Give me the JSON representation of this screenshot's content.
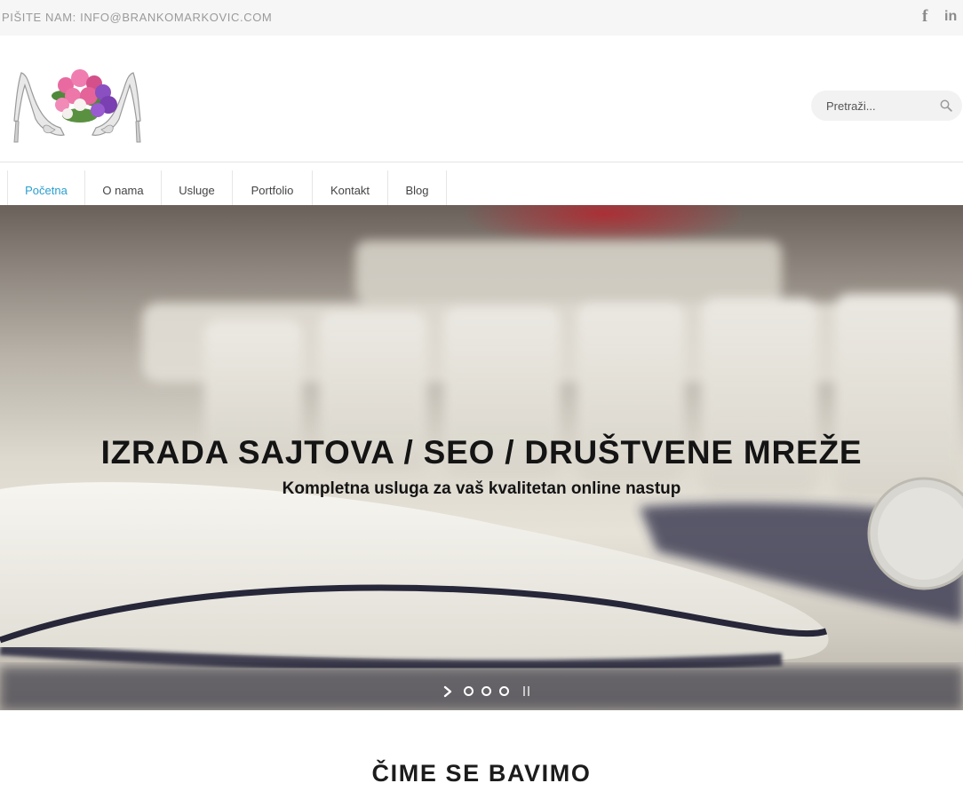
{
  "topbar": {
    "email_text": "PIŠITE NAM: INFO@BRANKOMARKOVIC.COM",
    "social_facebook": "f",
    "social_linkedin": "in"
  },
  "search": {
    "placeholder": "Pretraži..."
  },
  "nav": {
    "items": [
      {
        "label": "Početna",
        "active": true
      },
      {
        "label": "O nama"
      },
      {
        "label": "Usluge"
      },
      {
        "label": "Portfolio"
      },
      {
        "label": "Kontakt"
      },
      {
        "label": "Blog"
      }
    ]
  },
  "hero": {
    "title": "IZRADA SAJTOVA / SEO / DRUŠTVENE MREŽE",
    "subtitle": "Kompletna usluga za vaš kvalitetan online nastup"
  },
  "section": {
    "title": "ČIME SE BAVIMO"
  },
  "colors": {
    "accent": "#2a9fd0",
    "topbar_bg": "#f6f6f6",
    "text_dark": "#141414"
  }
}
